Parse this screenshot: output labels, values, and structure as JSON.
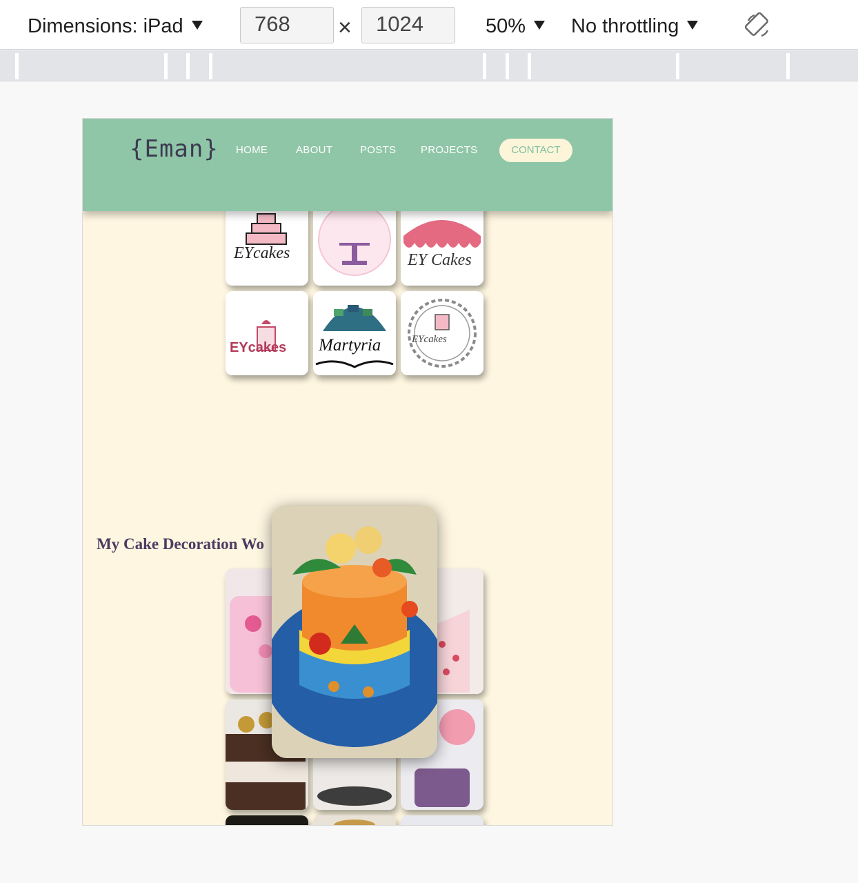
{
  "devtools": {
    "dimensions_label": "Dimensions: iPad",
    "width_value": "768",
    "height_value": "1024",
    "times_symbol": "×",
    "zoom": "50%",
    "throttling": "No throttling",
    "rotate_icon": "rotate-device-icon"
  },
  "site": {
    "logo": "{Eman}",
    "nav": {
      "home": "HOME",
      "about": "ABOUT",
      "posts": "POSTS",
      "projects": "PROJECTS",
      "contact": "CONTACT"
    },
    "logo_tiles": [
      {
        "name": "ey-cakes-logo-1",
        "text": "EYcakes"
      },
      {
        "name": "ey-cakes-logo-2",
        "text": ""
      },
      {
        "name": "ey-cakes-logo-3",
        "text": "EY Cakes"
      },
      {
        "name": "ey-cakes-logo-4",
        "text": "EYcakes"
      },
      {
        "name": "martyria-logo",
        "text": "Martyria"
      },
      {
        "name": "ey-cakes-logo-5",
        "text": "EYcakes"
      }
    ],
    "cake_section_title": "My Cake Decoration Wo",
    "photo_tiles": [
      "pink-birthday-cake-photo",
      "red-dotted-cake-photo",
      "chocolate-drip-cake-photo",
      "grey-cake-photo",
      "balloon-cake-photo",
      "dark-cake-photo",
      "cookie-cake-photo",
      "white-cake-photo"
    ],
    "popup_image": "tropical-flower-cake-photo",
    "colors": {
      "navbar": "#8fc6a7",
      "page_bg": "#fef6e0",
      "title": "#4b3b62",
      "contact_text": "#7cc19f"
    }
  }
}
